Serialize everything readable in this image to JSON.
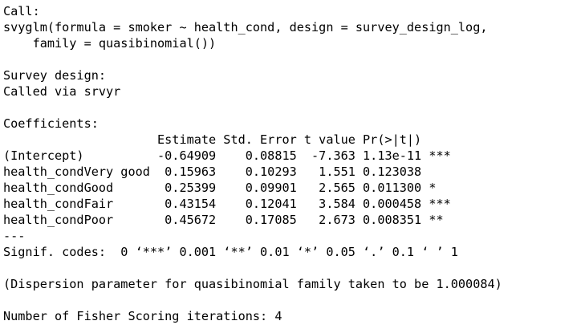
{
  "console": {
    "lines": [
      "Call:",
      "svyglm(formula = smoker ~ health_cond, design = survey_design_log,",
      "    family = quasibinomial())",
      "",
      "Survey design:",
      "Called via srvyr",
      "",
      "Coefficients:",
      "                     Estimate Std. Error t value Pr(>|t|)    ",
      "(Intercept)          -0.64909    0.08815  -7.363 1.13e-11 ***",
      "health_condVery good  0.15963    0.10293   1.551 0.123038    ",
      "health_condGood       0.25399    0.09901   2.565 0.011300 *  ",
      "health_condFair       0.43154    0.12041   3.584 0.000458 ***",
      "health_condPoor       0.45672    0.17085   2.673 0.008351 ** ",
      "---",
      "Signif. codes:  0 ‘***’ 0.001 ‘**’ 0.01 ‘*’ 0.05 ‘.’ 0.1 ‘ ’ 1",
      "",
      "(Dispersion parameter for quasibinomial family taken to be 1.000084)",
      "",
      "Number of Fisher Scoring iterations: 4"
    ]
  }
}
